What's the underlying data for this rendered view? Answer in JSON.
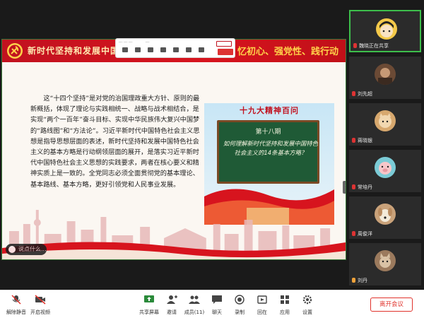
{
  "slide": {
    "header_title_left": "新时代坚持和发展中国",
    "header_title_right": "忆初心、强党性、践行动",
    "body_text": "这“十四个坚持”是对党的治国理政重大方针、原则的最新概括，体现了理论与实践相统一、战略与战术相结合，是实现“两个一百年”奋斗目标、实现中华民族伟大复兴中国梦的“路线图”和“方法论”。习近平新时代中国特色社会主义思想是指导思想层面的表述，新时代坚持和发展中国特色社会主义的基本方略是行动纲领层面的展开，是落实习近平新时代中国特色社会主义思想的实践要求，两者在核心要义和精神实质上是一致的。全党同志必须全面贯彻党的基本理论、基本路线、基本方略，更好引领党和人民事业发展。",
    "poster": {
      "title": "十九大精神百问",
      "issue": "第十八期",
      "question": "如何理解新时代坚持和发展中国特色社会主义的14条基本方略？"
    },
    "chat_placeholder": "说点什么..."
  },
  "participants": [
    {
      "name": "魏晓正在共享",
      "active": true,
      "avatar": "cartoon-girl",
      "color": "#f4c94a"
    },
    {
      "name": "刘先超",
      "active": false,
      "avatar": "photo",
      "color": "#6b4a35"
    },
    {
      "name": "蒋晓银",
      "active": false,
      "avatar": "cartoon-cat",
      "color": "#d7a86e"
    },
    {
      "name": "常培丹",
      "active": false,
      "avatar": "cartoon-pig",
      "color": "#7bcbd6"
    },
    {
      "name": "周俊洋",
      "active": false,
      "avatar": "dog",
      "color": "#c9a27a"
    },
    {
      "name": "刘丹",
      "active": false,
      "avatar": "cat",
      "color": "#9b7a5d"
    }
  ],
  "toolbar": {
    "left": [
      {
        "id": "mute",
        "label": "解除静音",
        "icon": "mic-muted-icon"
      },
      {
        "id": "video",
        "label": "开启视频",
        "icon": "camera-off-icon"
      }
    ],
    "center": [
      {
        "id": "share",
        "label": "共享屏幕",
        "icon": "share-screen-icon"
      },
      {
        "id": "invite",
        "label": "邀请",
        "icon": "invite-icon"
      },
      {
        "id": "members",
        "label": "成员(11)",
        "icon": "members-icon"
      },
      {
        "id": "chat",
        "label": "聊天",
        "icon": "chat-icon"
      },
      {
        "id": "record",
        "label": "录制",
        "icon": "record-icon"
      },
      {
        "id": "replay",
        "label": "回在",
        "icon": "replay-icon"
      },
      {
        "id": "apps",
        "label": "应用",
        "icon": "apps-icon"
      },
      {
        "id": "settings",
        "label": "设置",
        "icon": "gear-icon"
      }
    ],
    "leave_label": "离开会议"
  },
  "colors": {
    "header_red": "#d7141e",
    "accent_green": "#3dbf4b",
    "leave_red": "#e0322b"
  }
}
